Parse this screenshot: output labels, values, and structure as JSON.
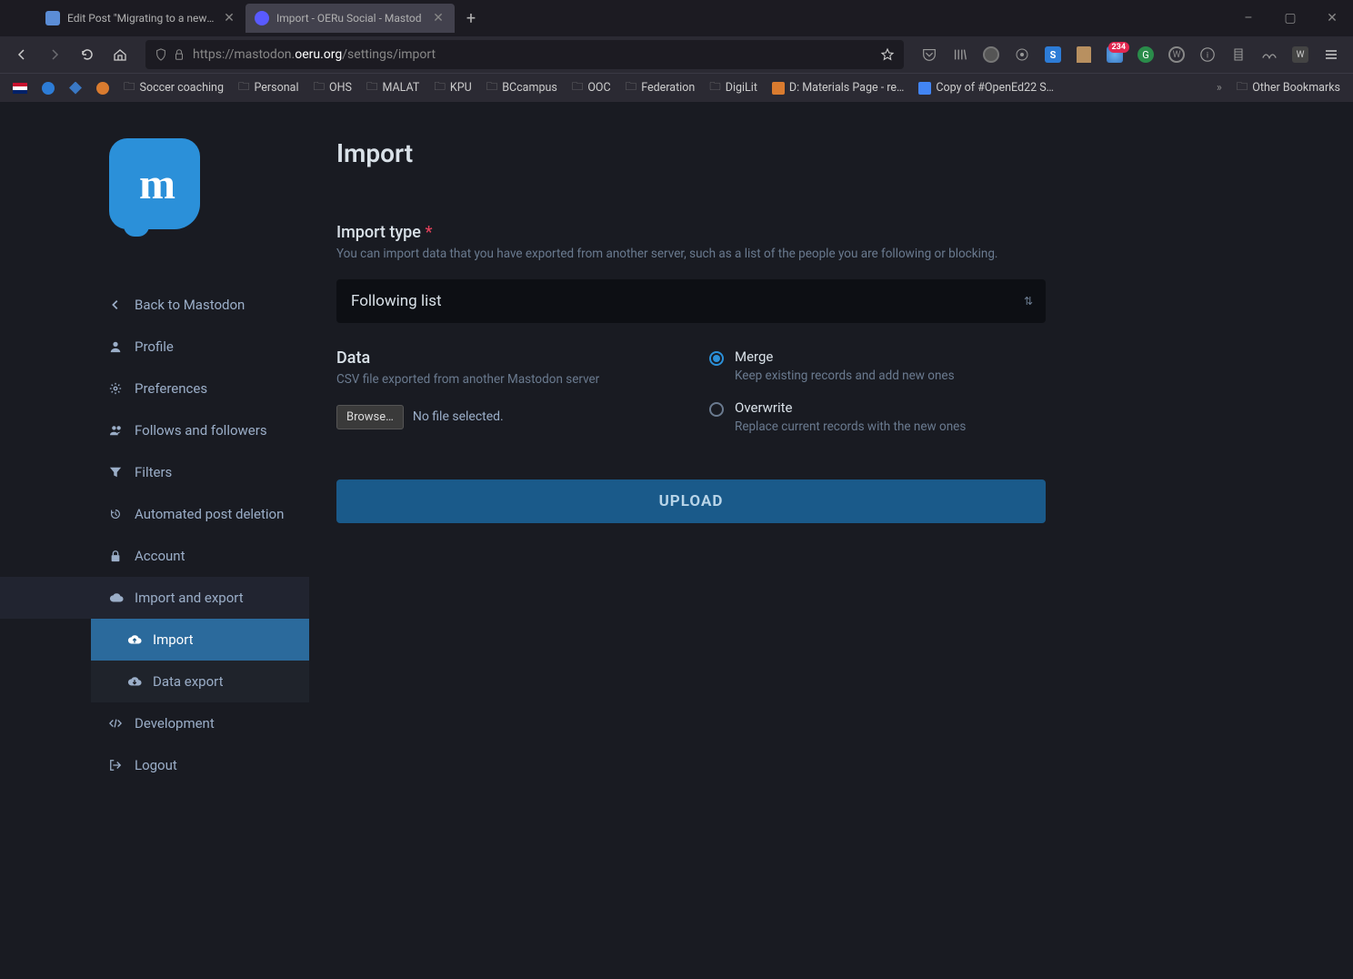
{
  "browser": {
    "tabs": [
      {
        "title": "Edit Post \"Migrating to a new M",
        "active": false,
        "favicon_color": "#5b8dd6"
      },
      {
        "title": "Import - OERu Social - Mastod",
        "active": true,
        "favicon_color": "#595aff"
      }
    ],
    "window_controls": {
      "min": "–",
      "max": "▢",
      "close": "✕"
    },
    "url_prefix": "https://",
    "url_mid": "mastodon.",
    "url_domain": "oeru.org",
    "url_suffix": "/settings/import",
    "ext_badge": "234",
    "bookmarks": [
      {
        "label": "Soccer coaching",
        "type": "folder"
      },
      {
        "label": "Personal",
        "type": "folder"
      },
      {
        "label": "OHS",
        "type": "folder"
      },
      {
        "label": "MALAT",
        "type": "folder"
      },
      {
        "label": "KPU",
        "type": "folder"
      },
      {
        "label": "BCcampus",
        "type": "folder"
      },
      {
        "label": "OOC",
        "type": "folder"
      },
      {
        "label": "Federation",
        "type": "folder"
      },
      {
        "label": "DigiLit",
        "type": "folder"
      },
      {
        "label": "D: Materials Page - re…",
        "type": "link",
        "color": "#d97b2f"
      },
      {
        "label": "Copy of #OpenEd22 S…",
        "type": "link",
        "color": "#4285f4"
      }
    ],
    "other_bookmarks": "Other Bookmarks"
  },
  "sidebar": {
    "items": [
      {
        "icon": "chevron-left",
        "label": "Back to Mastodon"
      },
      {
        "icon": "user",
        "label": "Profile"
      },
      {
        "icon": "gear",
        "label": "Preferences"
      },
      {
        "icon": "users",
        "label": "Follows and followers"
      },
      {
        "icon": "filter",
        "label": "Filters"
      },
      {
        "icon": "history",
        "label": "Automated post deletion"
      },
      {
        "icon": "lock",
        "label": "Account"
      },
      {
        "icon": "cloud",
        "label": "Import and export",
        "expanded": true,
        "children": [
          {
            "icon": "cloud-up",
            "label": "Import",
            "active": true
          },
          {
            "icon": "cloud-down",
            "label": "Data export"
          }
        ]
      },
      {
        "icon": "code",
        "label": "Development"
      },
      {
        "icon": "logout",
        "label": "Logout"
      }
    ]
  },
  "content": {
    "page_title": "Import",
    "import_type_label": "Import type",
    "import_type_hint": "You can import data that you have exported from another server, such as a list of the people you are following or blocking.",
    "select_value": "Following list",
    "data_label": "Data",
    "data_hint": "CSV file exported from another Mastodon server",
    "browse_label": "Browse…",
    "file_status": "No file selected.",
    "radio_merge_label": "Merge",
    "radio_merge_desc": "Keep existing records and add new ones",
    "radio_overwrite_label": "Overwrite",
    "radio_overwrite_desc": "Replace current records with the new ones",
    "upload_label": "UPLOAD"
  }
}
